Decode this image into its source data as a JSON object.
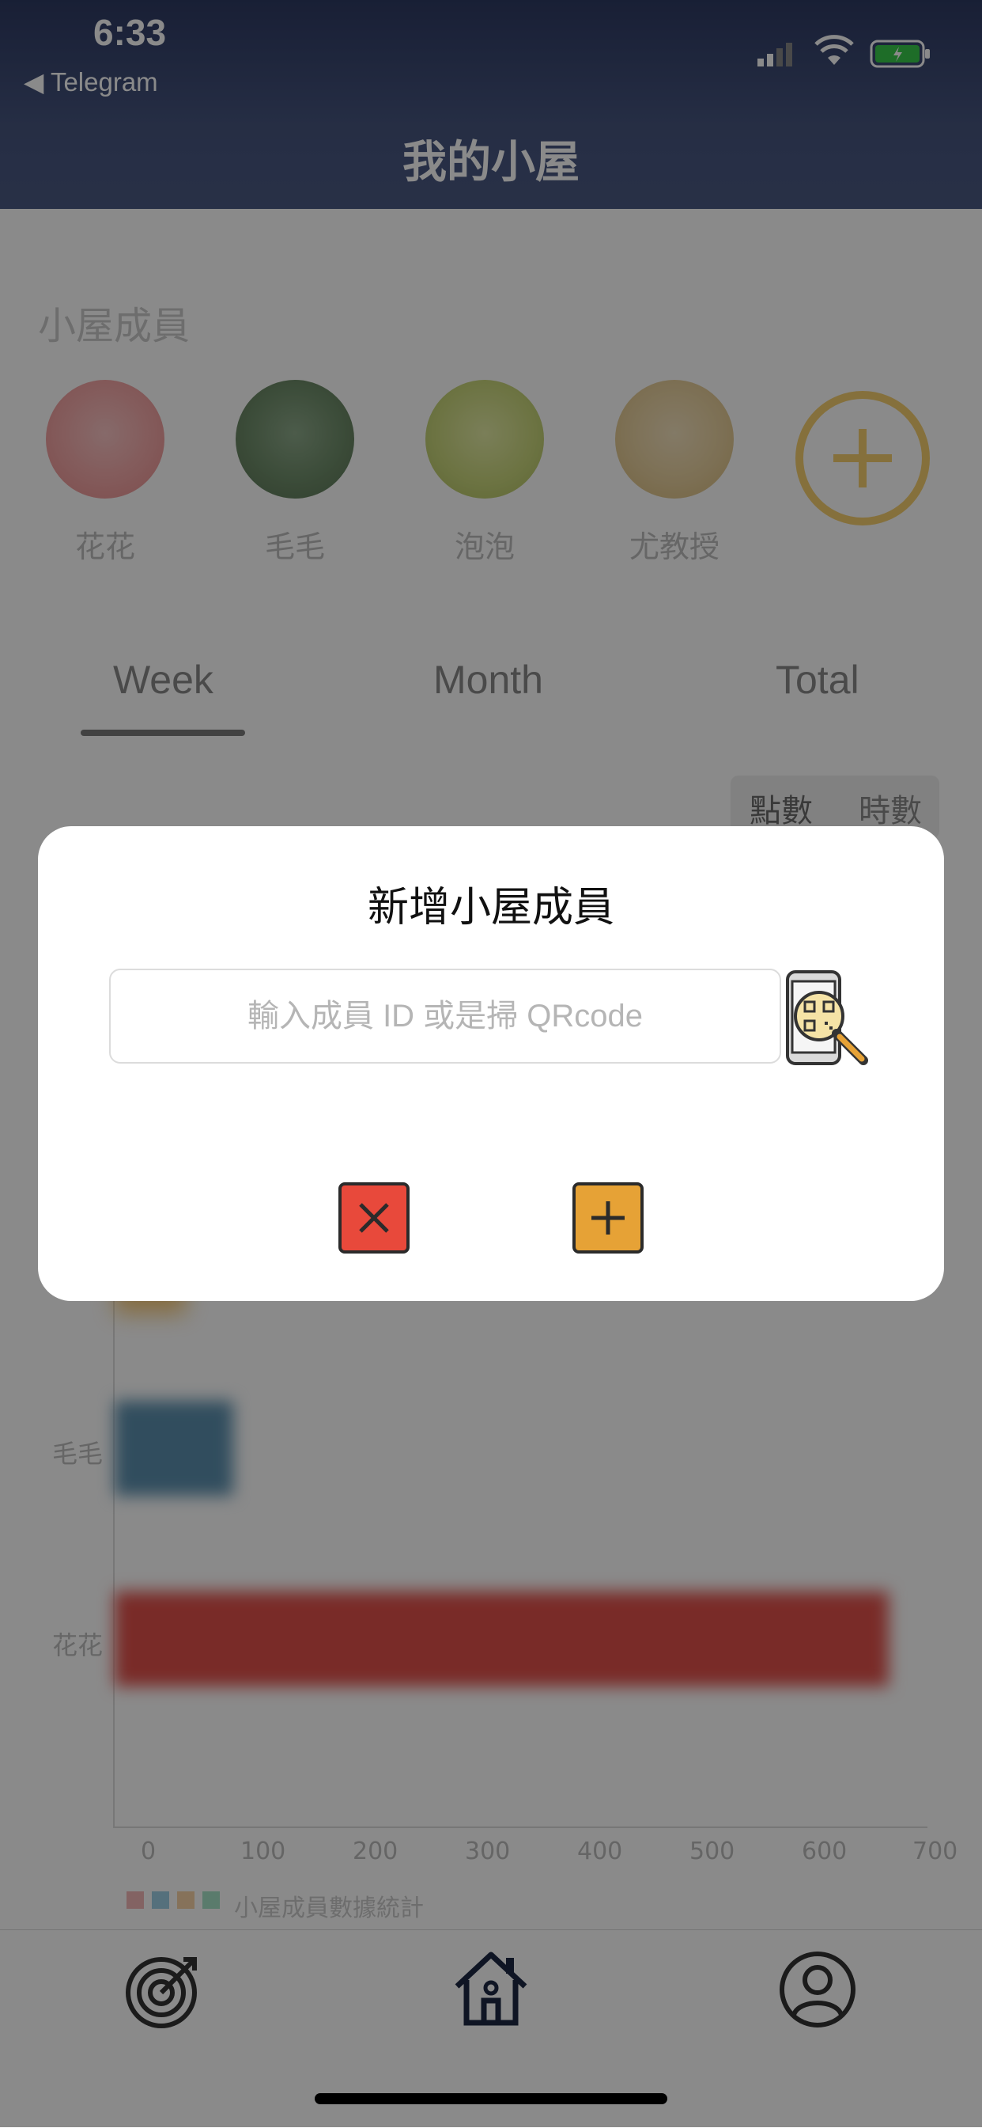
{
  "status": {
    "time": "6:33",
    "back_app": "◀ Telegram"
  },
  "header": {
    "title": "我的小屋"
  },
  "members": {
    "section_title": "小屋成員",
    "items": [
      {
        "name": "花花",
        "color": "#f3a6a6"
      },
      {
        "name": "毛毛",
        "color": "#6e8c69"
      },
      {
        "name": "泡泡",
        "color": "#c9d67c"
      },
      {
        "name": "尤教授",
        "color": "#e7cf9c"
      }
    ]
  },
  "tabs": [
    "Week",
    "Month",
    "Total"
  ],
  "segment": {
    "points": "點數",
    "hours": "時數"
  },
  "chart_data": {
    "type": "bar",
    "orientation": "horizontal",
    "categories": [
      "毛毛",
      "花花"
    ],
    "values": [
      105,
      685
    ],
    "colors": [
      "#5b8fae",
      "#e0504a"
    ],
    "xticks": [
      "0",
      "100",
      "200",
      "300",
      "400",
      "500",
      "600",
      "700"
    ],
    "xlim": [
      0,
      700
    ],
    "legend_label": "小屋成員數據統計",
    "legend_colors": [
      "#f2b8b8",
      "#9ecfe6",
      "#f7d2a6",
      "#a6e3c8"
    ]
  },
  "modal": {
    "title": "新增小屋成員",
    "input_placeholder": "輸入成員 ID 或是掃 QRcode",
    "cancel_icon": "close-icon",
    "confirm_icon": "plus-icon",
    "cancel_color": "#e8493b",
    "confirm_color": "#e6a236"
  },
  "tabbar": {
    "items": [
      "target-icon",
      "home-icon",
      "user-icon"
    ]
  }
}
